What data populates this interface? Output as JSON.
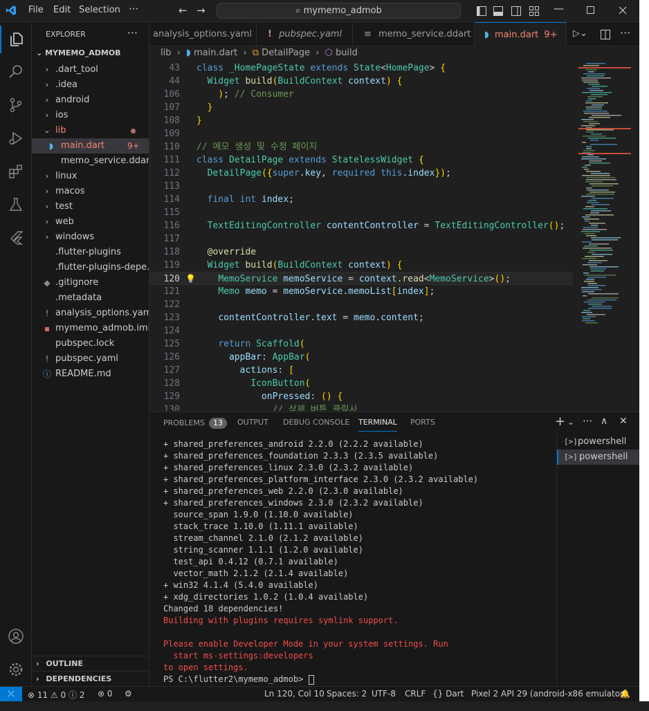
{
  "titlebar": {
    "menu": [
      "File",
      "Edit",
      "Selection"
    ],
    "search": "mymemo_admob"
  },
  "explorer": {
    "header": "EXPLORER",
    "root": "MYMEMO_ADMOB",
    "items": [
      {
        "label": ".dart_tool",
        "type": "folder"
      },
      {
        "label": ".idea",
        "type": "folder"
      },
      {
        "label": "android",
        "type": "folder"
      },
      {
        "label": "ios",
        "type": "folder"
      },
      {
        "label": "lib",
        "type": "folder-open"
      },
      {
        "label": "main.dart",
        "type": "dart",
        "badge": "9+"
      },
      {
        "label": "memo_service.ddart",
        "type": "file"
      },
      {
        "label": "linux",
        "type": "folder"
      },
      {
        "label": "macos",
        "type": "folder"
      },
      {
        "label": "test",
        "type": "folder"
      },
      {
        "label": "web",
        "type": "folder"
      },
      {
        "label": "windows",
        "type": "folder"
      },
      {
        "label": ".flutter-plugins",
        "type": "file"
      },
      {
        "label": ".flutter-plugins-depe...",
        "type": "file"
      },
      {
        "label": ".gitignore",
        "type": "git"
      },
      {
        "label": ".metadata",
        "type": "file"
      },
      {
        "label": "analysis_options.yaml",
        "type": "yaml"
      },
      {
        "label": "mymemo_admob.iml",
        "type": "iml"
      },
      {
        "label": "pubspec.lock",
        "type": "file"
      },
      {
        "label": "pubspec.yaml",
        "type": "yaml"
      },
      {
        "label": "README.md",
        "type": "info"
      }
    ],
    "outline": "OUTLINE",
    "dependencies": "DEPENDENCIES"
  },
  "tabs": [
    {
      "label": "analysis_options.yaml"
    },
    {
      "label": "pubspec.yaml"
    },
    {
      "label": "memo_service.ddart"
    },
    {
      "label": "main.dart",
      "badge": "9+"
    }
  ],
  "breadcrumb": [
    "lib",
    "main.dart",
    "DetailPage",
    "build"
  ],
  "code": [
    {
      "n": "43",
      "text": "class _HomePageState extends State<HomePage> {"
    },
    {
      "n": "44",
      "text": "  Widget build(BuildContext context) {"
    },
    {
      "n": "106",
      "text": "    ); // Consumer"
    },
    {
      "n": "107",
      "text": "  }"
    },
    {
      "n": "108",
      "text": "}"
    },
    {
      "n": "109",
      "text": ""
    },
    {
      "n": "110",
      "text": "// 메모 생성 및 수정 페이지"
    },
    {
      "n": "111",
      "text": "class DetailPage extends StatelessWidget {"
    },
    {
      "n": "112",
      "text": "  DetailPage({super.key, required this.index});"
    },
    {
      "n": "113",
      "text": ""
    },
    {
      "n": "114",
      "text": "  final int index;"
    },
    {
      "n": "115",
      "text": ""
    },
    {
      "n": "116",
      "text": "  TextEditingController contentController = TextEditingController();"
    },
    {
      "n": "117",
      "text": ""
    },
    {
      "n": "118",
      "text": "  @override"
    },
    {
      "n": "119",
      "text": "  Widget build(BuildContext context) {"
    },
    {
      "n": "120",
      "text": "    MemoService memoService = context.read<MemoService>();"
    },
    {
      "n": "121",
      "text": "    Memo memo = memoService.memoList[index];"
    },
    {
      "n": "122",
      "text": ""
    },
    {
      "n": "123",
      "text": "    contentController.text = memo.content;"
    },
    {
      "n": "124",
      "text": ""
    },
    {
      "n": "125",
      "text": "    return Scaffold("
    },
    {
      "n": "126",
      "text": "      appBar: AppBar("
    },
    {
      "n": "127",
      "text": "        actions: ["
    },
    {
      "n": "128",
      "text": "          IconButton("
    },
    {
      "n": "129",
      "text": "            onPressed: () {"
    },
    {
      "n": "130",
      "text": "              // 삭제 버튼 클릭시"
    }
  ],
  "panel": {
    "tabs": [
      "PROBLEMS",
      "OUTPUT",
      "DEBUG CONSOLE",
      "TERMINAL",
      "PORTS"
    ],
    "problems_count": "13",
    "terminals": [
      "powershell",
      "powershell"
    ],
    "terminal_lines": [
      {
        "text": "+ shared_preferences_android 2.2.0 (2.2.2 available)",
        "err": false
      },
      {
        "text": "+ shared_preferences_foundation 2.3.3 (2.3.5 available)",
        "err": false
      },
      {
        "text": "+ shared_preferences_linux 2.3.0 (2.3.2 available)",
        "err": false
      },
      {
        "text": "+ shared_preferences_platform_interface 2.3.0 (2.3.2 available)",
        "err": false
      },
      {
        "text": "+ shared_preferences_web 2.2.0 (2.3.0 available)",
        "err": false
      },
      {
        "text": "+ shared_preferences_windows 2.3.0 (2.3.2 available)",
        "err": false
      },
      {
        "text": "  source_span 1.9.0 (1.10.0 available)",
        "err": false
      },
      {
        "text": "  stack_trace 1.10.0 (1.11.1 available)",
        "err": false
      },
      {
        "text": "  stream_channel 2.1.0 (2.1.2 available)",
        "err": false
      },
      {
        "text": "  string_scanner 1.1.1 (1.2.0 available)",
        "err": false
      },
      {
        "text": "  test_api 0.4.12 (0.7.1 available)",
        "err": false
      },
      {
        "text": "  vector_math 2.1.2 (2.1.4 available)",
        "err": false
      },
      {
        "text": "+ win32 4.1.4 (5.4.0 available)",
        "err": false
      },
      {
        "text": "+ xdg_directories 1.0.2 (1.0.4 available)",
        "err": false
      },
      {
        "text": "Changed 18 dependencies!",
        "err": false
      },
      {
        "text": "Building with plugins requires symlink support.",
        "err": true
      },
      {
        "text": "",
        "err": false
      },
      {
        "text": "Please enable Developer Mode in your system settings. Run",
        "err": true
      },
      {
        "text": "  start ms-settings:developers",
        "err": true
      },
      {
        "text": "to open settings.",
        "err": true
      },
      {
        "text": "PS C:\\flutter2\\mymemo_admob> ",
        "err": false
      }
    ]
  },
  "status": {
    "errors": "11",
    "warnings": "0",
    "infos": "2",
    "ports": "0",
    "position": "Ln 120, Col 10",
    "spaces": "Spaces: 2",
    "encoding": "UTF-8",
    "eol": "CRLF",
    "language": "Dart",
    "device": "Pixel 2 API 29 (android-x86 emulator)"
  },
  "colors": {
    "accent": "#0078d4",
    "keyword": "#569cd6",
    "type": "#4ec9b0",
    "function": "#dcdcaa",
    "variable": "#9cdcfe",
    "comment": "#6a9955",
    "error": "#f14c4c",
    "folder_lib": "#f48771"
  }
}
